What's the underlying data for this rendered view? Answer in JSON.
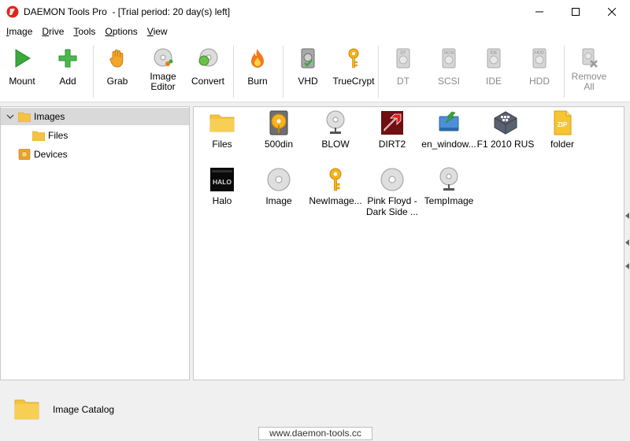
{
  "window": {
    "title": "DAEMON Tools Pro  - [Trial period: 20 day(s) left]"
  },
  "menu": [
    {
      "label": "Image",
      "underline": "I",
      "rest": "mage"
    },
    {
      "label": "Drive",
      "underline": "D",
      "rest": "rive"
    },
    {
      "label": "Tools",
      "underline": "T",
      "rest": "ools"
    },
    {
      "label": "Options",
      "underline": "O",
      "rest": "ptions"
    },
    {
      "label": "View",
      "underline": "V",
      "rest": "iew"
    }
  ],
  "toolbar": {
    "mount": "Mount",
    "add": "Add",
    "grab": "Grab",
    "image_editor": "Image\nEditor",
    "convert": "Convert",
    "burn": "Burn",
    "vhd": "VHD",
    "truecrypt": "TrueCrypt",
    "dt": "DT",
    "scsi": "SCSI",
    "ide": "IDE",
    "hdd": "HDD",
    "remove_all": "Remove\nAll",
    "dt_badge": "DT",
    "scsi_badge": "SCSI",
    "ide_badge": "IDE",
    "hdd_badge": "HDD"
  },
  "tree": {
    "images": "Images",
    "files": "Files",
    "devices": "Devices"
  },
  "items": [
    {
      "label": "Files",
      "icon": "folder-icon"
    },
    {
      "label": "500din",
      "icon": "hdd-image-icon"
    },
    {
      "label": "BLOW",
      "icon": "disc-mount-icon"
    },
    {
      "label": "DIRT2",
      "icon": "game-cover-icon"
    },
    {
      "label": "en_window...",
      "icon": "install-image-icon"
    },
    {
      "label": "F1 2010 RUS",
      "icon": "vhd-image-icon"
    },
    {
      "label": "folder",
      "icon": "zip-icon"
    },
    {
      "label": "Halo",
      "icon": "halo-cover-icon"
    },
    {
      "label": "Image",
      "icon": "disc-icon"
    },
    {
      "label": "NewImage...",
      "icon": "key-icon"
    },
    {
      "label": "Pink Floyd -\nDark Side ...",
      "icon": "disc-icon"
    },
    {
      "label": "TempImage",
      "icon": "disc-mount-icon"
    }
  ],
  "halo_cover_text": "HALO",
  "zip_badge": "ZIP",
  "bottom": {
    "catalog": "Image Catalog",
    "watermark": "www.daemon-tools.cc"
  },
  "colors": {
    "accent_green": "#3aa83a",
    "flame_orange": "#f07a1a",
    "folder_yellow": "#f5c242",
    "logo_red": "#e0261c"
  }
}
